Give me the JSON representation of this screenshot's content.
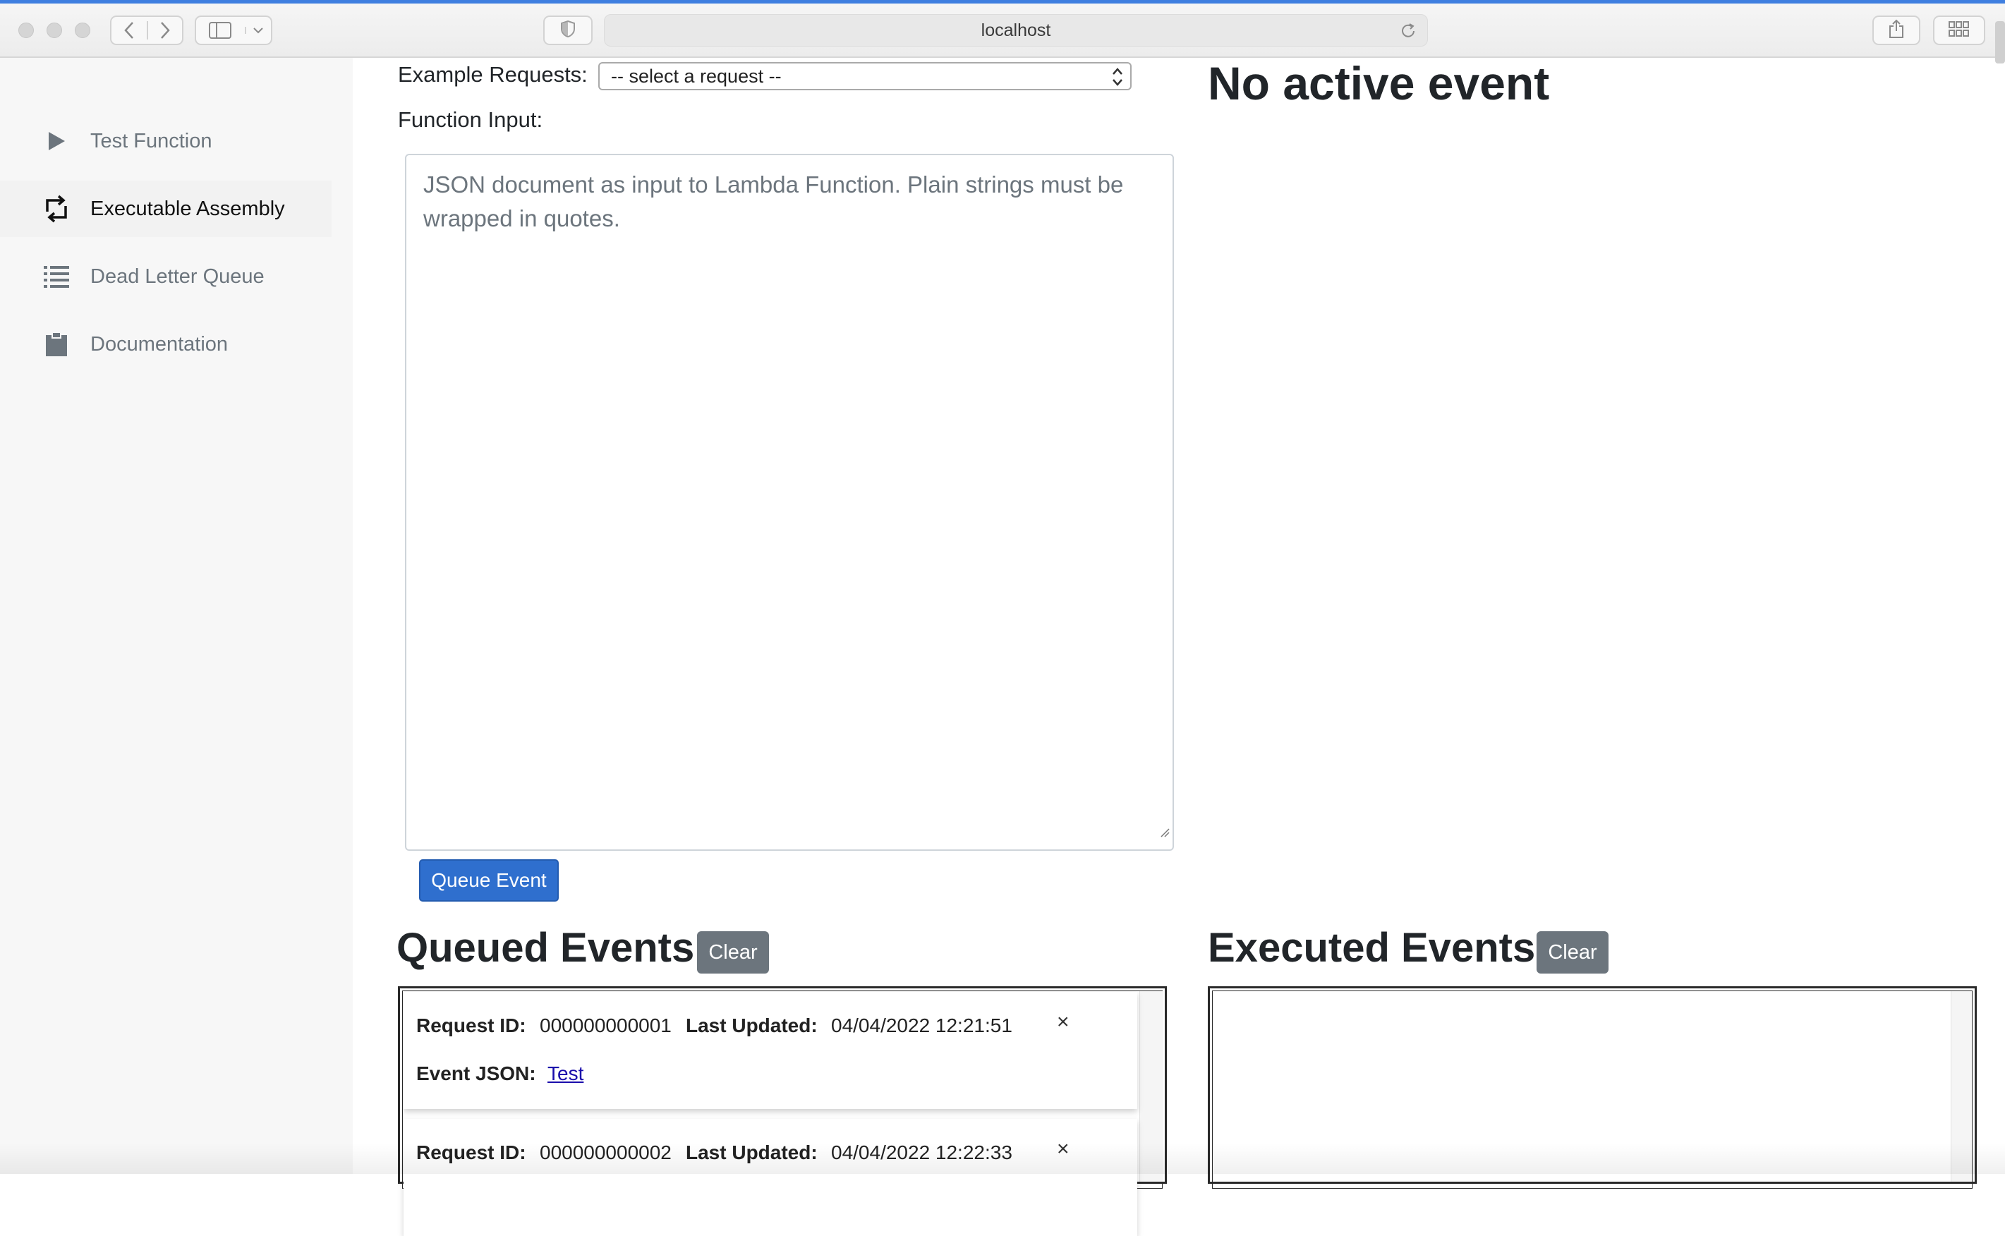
{
  "browser": {
    "url": "localhost"
  },
  "sidebar": {
    "items": [
      {
        "label": "Test Function",
        "icon": "play-icon",
        "active": false
      },
      {
        "label": "Executable Assembly",
        "icon": "repeat-icon",
        "active": true
      },
      {
        "label": "Dead Letter Queue",
        "icon": "list-icon",
        "active": false
      },
      {
        "label": "Documentation",
        "icon": "clipboard-icon",
        "active": false
      }
    ]
  },
  "form": {
    "example_label": "Example Requests:",
    "example_selected": "-- select a request --",
    "input_label": "Function Input:",
    "input_placeholder": "JSON document as input to Lambda Function. Plain strings must be wrapped in quotes.",
    "queue_button": "Queue Event"
  },
  "active_event": {
    "heading": "No active event"
  },
  "queued": {
    "heading": "Queued Events:",
    "clear_label": "Clear",
    "events": [
      {
        "request_id_label": "Request ID:",
        "request_id": "000000000001",
        "last_updated_label": "Last Updated:",
        "last_updated": "04/04/2022 12:21:51",
        "event_json_label": "Event JSON:",
        "event_json_link": "Test",
        "remove_label": "×"
      },
      {
        "request_id_label": "Request ID:",
        "request_id": "000000000002",
        "last_updated_label": "Last Updated:",
        "last_updated": "04/04/2022 12:22:33",
        "remove_label": "×"
      }
    ]
  },
  "executed": {
    "heading": "Executed Events:",
    "clear_label": "Clear"
  },
  "colors": {
    "primary": "#2f6fce",
    "secondary": "#6c757d",
    "sidebar_bg": "#f7f7f7"
  }
}
